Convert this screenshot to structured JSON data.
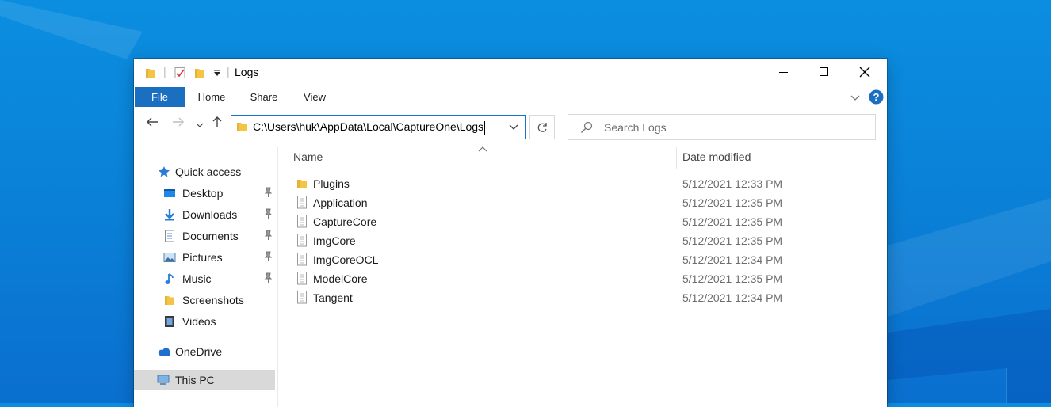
{
  "window": {
    "title": "Logs"
  },
  "ribbon": {
    "tabs": [
      {
        "label": "File"
      },
      {
        "label": "Home"
      },
      {
        "label": "Share"
      },
      {
        "label": "View"
      }
    ]
  },
  "address": {
    "path": "C:\\Users\\huk\\AppData\\Local\\CaptureOne\\Logs"
  },
  "search": {
    "placeholder": "Search Logs"
  },
  "columns": {
    "name": "Name",
    "date": "Date modified"
  },
  "sidebar": {
    "items": [
      {
        "label": "Quick access",
        "icon": "star-icon"
      },
      {
        "label": "Desktop",
        "icon": "desktop-icon",
        "pinned": true
      },
      {
        "label": "Downloads",
        "icon": "download-icon",
        "pinned": true
      },
      {
        "label": "Documents",
        "icon": "documents-icon",
        "pinned": true
      },
      {
        "label": "Pictures",
        "icon": "pictures-icon",
        "pinned": true
      },
      {
        "label": "Music",
        "icon": "music-icon",
        "pinned": true
      },
      {
        "label": "Screenshots",
        "icon": "folder-icon"
      },
      {
        "label": "Videos",
        "icon": "videos-icon"
      },
      {
        "label": "OneDrive",
        "icon": "onedrive-icon"
      },
      {
        "label": "This PC",
        "icon": "computer-icon",
        "selected": true
      }
    ]
  },
  "files": [
    {
      "name": "Plugins",
      "type": "folder",
      "date": "5/12/2021 12:33 PM"
    },
    {
      "name": "Application",
      "type": "file",
      "date": "5/12/2021 12:35 PM"
    },
    {
      "name": "CaptureCore",
      "type": "file",
      "date": "5/12/2021 12:35 PM"
    },
    {
      "name": "ImgCore",
      "type": "file",
      "date": "5/12/2021 12:35 PM"
    },
    {
      "name": "ImgCoreOCL",
      "type": "file",
      "date": "5/12/2021 12:34 PM"
    },
    {
      "name": "ModelCore",
      "type": "file",
      "date": "5/12/2021 12:35 PM"
    },
    {
      "name": "Tangent",
      "type": "file",
      "date": "5/12/2021 12:34 PM"
    }
  ],
  "colors": {
    "accent": "#1a6fc1",
    "desktop": "#0a7fd6",
    "folder": "#f4c542"
  }
}
